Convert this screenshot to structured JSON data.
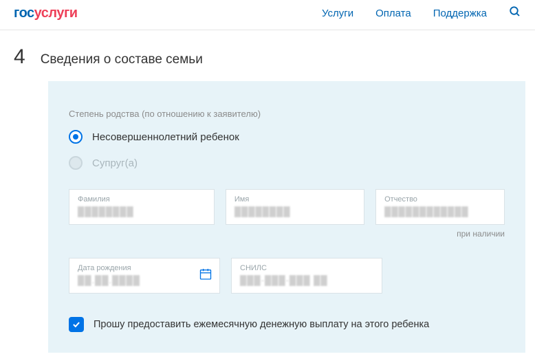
{
  "header": {
    "logo_part1": "гос",
    "logo_part2": "услуги",
    "nav": {
      "services": "Услуги",
      "payment": "Оплата",
      "support": "Поддержка"
    }
  },
  "step": {
    "number": "4",
    "title": "Сведения о составе семьи"
  },
  "form": {
    "relation_label": "Степень родства (по отношению к заявителю)",
    "relation_options": {
      "minor_child": "Несовершеннолетний ребенок",
      "spouse": "Супруг(а)"
    },
    "fields": {
      "surname": {
        "label": "Фамилия",
        "value": "████████"
      },
      "name": {
        "label": "Имя",
        "value": "████████"
      },
      "patronymic": {
        "label": "Отчество",
        "value": "████████████"
      },
      "birthdate": {
        "label": "Дата рождения",
        "value": "██.██.████"
      },
      "snils": {
        "label": "СНИЛС",
        "value": "███-███-███ ██"
      }
    },
    "hint_optional": "при наличии",
    "checkbox_payment": "Прошу предоставить ежемесячную денежную выплату на этого ребенка"
  }
}
